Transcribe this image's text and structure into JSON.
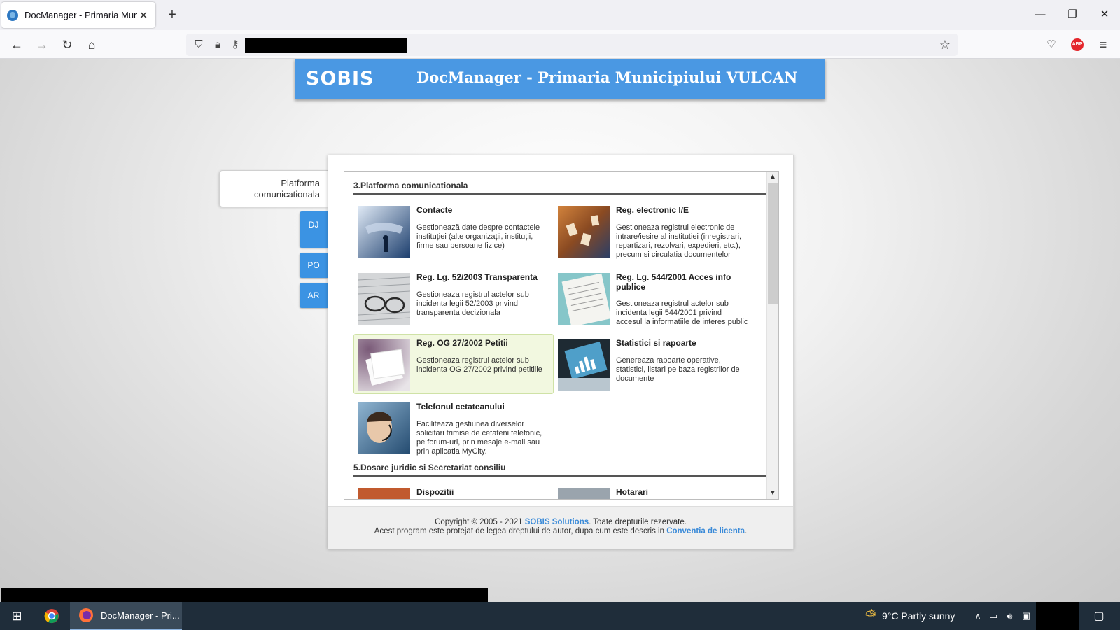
{
  "browser": {
    "tab_title": "DocManager - Primaria Municipiului VULCAN",
    "new_tab": "+",
    "window_controls": {
      "minimize": "—",
      "restore": "❐",
      "close": "✕"
    }
  },
  "header": {
    "logo": "SOBIS",
    "title": "DocManager - Primaria Municipiului VULCAN"
  },
  "side_tabs": {
    "active": [
      "Platforma",
      "comunicationala"
    ],
    "items": [
      "DJ",
      "PO",
      "AR"
    ]
  },
  "sections": [
    {
      "title": "3.Platforma comunicationala",
      "items": [
        {
          "title": "Contacte",
          "desc": "Gestionează date despre contactele instituției (alte organizații, instituții, firme sau persoane fizice)"
        },
        {
          "title": "Reg. electronic I/E",
          "desc": "Gestioneaza registrul electronic de intrare/iesire al institutiei (inregistrari, repartizari, rezolvari, expedieri, etc.), precum si circulatia documentelor"
        },
        {
          "title": "Reg. Lg. 52/2003 Transparenta",
          "desc": "Gestioneaza registrul actelor sub incidenta legii 52/2003 privind transparenta decizionala"
        },
        {
          "title": "Reg. Lg. 544/2001 Acces info publice",
          "desc": "Gestioneaza registrul actelor sub incidenta legii 544/2001 privind accesul la informatiile de interes public"
        },
        {
          "title": "Reg. OG 27/2002 Petitii",
          "desc": "Gestioneaza registrul actelor sub incidenta OG 27/2002 privind petitiile"
        },
        {
          "title": "Statistici si rapoarte",
          "desc": "Genereaza rapoarte operative, statistici, listari pe baza registrilor de documente"
        },
        {
          "title": "Telefonul cetateanului",
          "desc": "Faciliteaza gestiunea diverselor solicitari trimise de cetateni telefonic, pe forum-uri, prin mesaje e-mail sau prin aplicatia MyCity."
        }
      ]
    },
    {
      "title": "5.Dosare juridic si Secretariat consiliu",
      "items": [
        {
          "title": "Dispozitii"
        },
        {
          "title": "Hotarari"
        }
      ]
    }
  ],
  "footer": {
    "line1_prefix": "Copyright © 2005 - 2021 ",
    "line1_link": "SOBIS Solutions",
    "line1_suffix": ". Toate drepturile rezervate.",
    "line2_prefix": "Acest program este protejat de legea dreptului de autor, dupa cum este descris in ",
    "line2_link": "Conventia de licenta",
    "line2_suffix": "."
  },
  "taskbar": {
    "active_app": "DocManager - Pri...",
    "weather": "9°C  Partly sunny"
  },
  "colors": {
    "header_blue": "#4a98e3",
    "tab_blue": "#3b93e3",
    "highlight_bg": "#f2f8e0",
    "link": "#3a8ad8"
  }
}
